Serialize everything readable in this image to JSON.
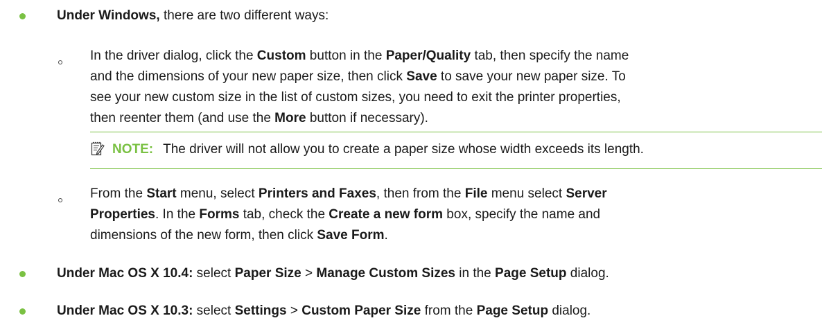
{
  "colors": {
    "accent": "#7ac143",
    "text": "#1a1a1a"
  },
  "windows": {
    "heading": "Under Windows,",
    "heading_rest": " there are two different ways:",
    "method1": {
      "l1_a": "In the driver dialog, click the ",
      "l1_custom": "Custom",
      "l1_b": " button in the ",
      "l1_tab": "Paper/Quality",
      "l1_c": " tab, then specify the name",
      "l2_a": "and the dimensions of your new paper size, then click ",
      "l2_save": "Save",
      "l2_b": " to save your new paper size. To",
      "l3": "see your new custom size in the list of custom sizes, you need to exit the printer properties,",
      "l4_a": "then reenter them (and use the ",
      "l4_more": "More",
      "l4_b": " button if necessary)."
    },
    "note": {
      "icon": "note-pencil-icon",
      "label": "NOTE:",
      "text": "The driver will not allow you to create a paper size whose width exceeds its length."
    },
    "method2": {
      "l1_a": "From the ",
      "l1_start": "Start",
      "l1_b": " menu, select ",
      "l1_printers": "Printers and Faxes",
      "l1_c": ", then from the ",
      "l1_file": "File",
      "l1_d": " menu select ",
      "l1_server": "Server",
      "l2_props": "Properties",
      "l2_a": ". In the ",
      "l2_forms": "Forms",
      "l2_b": " tab, check the ",
      "l2_create": "Create a new form",
      "l2_c": " box, specify the name and",
      "l3_a": "dimensions of the new form, then click ",
      "l3_saveform": "Save Form",
      "l3_b": "."
    }
  },
  "mac104": {
    "heading": "Under Mac OS X 10.4:",
    "a": " select ",
    "paper_size": "Paper Size",
    "gt": " > ",
    "manage": "Manage Custom Sizes",
    "b": " in the ",
    "page_setup": "Page Setup",
    "c": " dialog."
  },
  "mac103": {
    "heading": "Under Mac OS X 10.3:",
    "a": " select ",
    "settings": "Settings",
    "gt": " > ",
    "custom": "Custom Paper Size",
    "b": " from the ",
    "page_setup": "Page Setup",
    "c": " dialog."
  }
}
